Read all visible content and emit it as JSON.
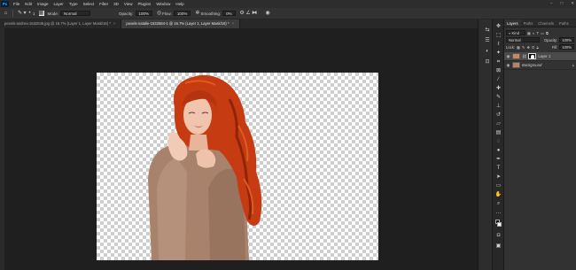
{
  "menubar": {
    "logo": "Ps",
    "items": [
      "File",
      "Edit",
      "Image",
      "Layer",
      "Type",
      "Select",
      "Filter",
      "3D",
      "View",
      "Plugins",
      "Window",
      "Help"
    ]
  },
  "options": {
    "mode_label": "Mode:",
    "mode_value": "Normal",
    "opacity_label": "Opacity:",
    "opacity_value": "100%",
    "flow_label": "Flow:",
    "flow_value": "100%",
    "smoothing_label": "Smoothing:",
    "smoothing_value": "0%",
    "brush_size": "1"
  },
  "tabs": [
    {
      "label": "pexels-andrea-1532546.jpg @ 16.7% (Layer 1, Layer Mask/16) *",
      "active": false
    },
    {
      "label": "pexels-natalie-1532584-1 @ 16.7% (Layer 1, Layer Mask/16) *",
      "active": true
    }
  ],
  "layers_panel": {
    "tabs": [
      "Layers",
      "Paths",
      "Channels",
      "Paths"
    ],
    "kind_label": "Kind",
    "blend_mode": "Normal",
    "opacity_label": "Opacity:",
    "opacity_value": "100%",
    "lock_label": "Lock:",
    "fill_label": "Fill:",
    "fill_value": "100%",
    "layers": [
      {
        "name": "Layer 1",
        "selected": true
      },
      {
        "name": "Background",
        "selected": false
      }
    ]
  },
  "colors": {
    "accent": "#31a8ff",
    "hair": "#c63b12",
    "coat": "#a8826a",
    "skin": "#f0c4ad"
  }
}
